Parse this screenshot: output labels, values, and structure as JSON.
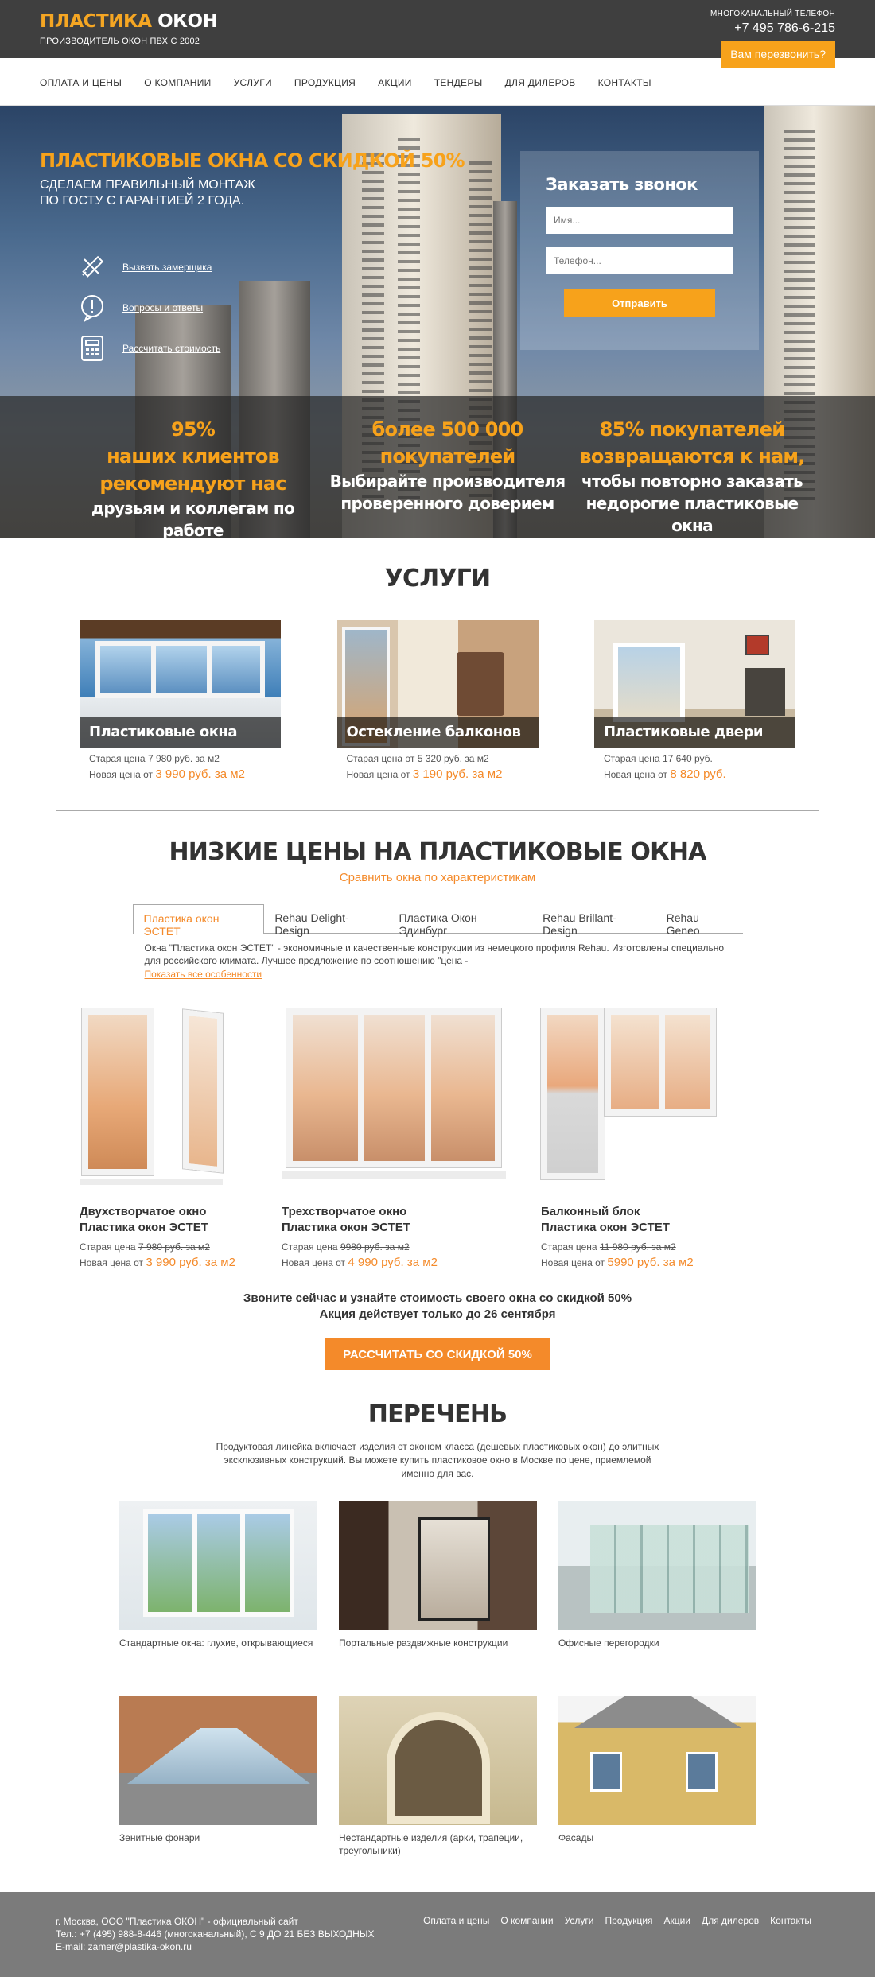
{
  "header": {
    "logo_part1": "ПЛАСТИКА",
    "logo_part2": "ОКОН",
    "tagline": "ПРОИЗВОДИТЕЛЬ ОКОН ПВХ С 2002",
    "phone_caption": "МНОГОКАНАЛЬНЫЙ ТЕЛЕФОН",
    "phone": "+7 495 786-6-215",
    "callback_label": "Вам перезвонить?"
  },
  "nav": {
    "items": [
      "ОПЛАТА И ЦЕНЫ",
      "О КОМПАНИИ",
      "УСЛУГИ",
      "ПРОДУКЦИЯ",
      "АКЦИИ",
      "ТЕНДЕРЫ",
      "ДЛЯ ДИЛЕРОВ",
      "КОНТАКТЫ"
    ]
  },
  "hero": {
    "title": "ПЛАСТИКОВЫЕ ОКНА СО СКИДКОЙ 50%",
    "subtitle_line1": "СДЕЛАЕМ ПРАВИЛЬНЫЙ МОНТАЖ",
    "subtitle_line2": "ПО ГОСТУ С ГАРАНТИЕЙ 2 ГОДА.",
    "links": [
      {
        "label": "Вызвать замерщика",
        "icon": "ruler-pencil-icon"
      },
      {
        "label": "Вопросы и ответы",
        "icon": "question-bubble-icon"
      },
      {
        "label": "Рассчитать стоимость",
        "icon": "calculator-icon"
      }
    ],
    "form": {
      "title": "Заказать звонок",
      "name_placeholder": "Имя...",
      "phone_placeholder": "Телефон...",
      "submit_label": "Отправить"
    },
    "stats": [
      {
        "orange1": "95%",
        "orange2": "наших клиентов",
        "orange3": "рекомендуют нас",
        "white1": "друзьям и коллегам по работе"
      },
      {
        "orange1": "более 500 000",
        "orange2": "покупателей",
        "white1": "Выбирайте производителя",
        "white2": "проверенного доверием"
      },
      {
        "orange1": "85% покупателей",
        "orange2": "возвращаются к нам,",
        "white1": "чтобы повторно заказать",
        "white2": "недорогие пластиковые окна"
      }
    ]
  },
  "services": {
    "title": "УСЛУГИ",
    "items": [
      {
        "name": "Пластиковые окна",
        "old_label": "Старая цена",
        "old_value": "7 980 руб. за м2",
        "new_label": "Новая цена от",
        "new_value": "3 990 руб. за м2"
      },
      {
        "name": "Остекление балконов",
        "old_label": "Старая цена от",
        "old_value": "5 320 руб. за м2",
        "new_label": "Новая цена от",
        "new_value": "3 190 руб. за м2"
      },
      {
        "name": "Пластиковые двери",
        "old_label": "Старая цена",
        "old_value": "17 640 руб.",
        "new_label": "Новая цена от",
        "new_value": "8 820 руб."
      }
    ]
  },
  "prices": {
    "title": "НИЗКИЕ ЦЕНЫ НА ПЛАСТИКОВЫЕ ОКНА",
    "subtitle": "Сравнить окна по характеристикам",
    "tabs": [
      "Пластика окон ЭСТЕТ",
      "Rehau Delight-Design",
      "Пластика Окон Эдинбург",
      "Rehau Brillant-Design",
      "Rehau Geneo"
    ],
    "description": "Окна \"Пластика окон ЭСТЕТ\" - экономичные и качественные конструкции из немецкого профиля Rehau. Изготовлены специально для российского климата. Лучшее предложение по соотношению \"цена -",
    "more_link": "Показать все особенности",
    "products": [
      {
        "name1": "Двухстворчатое окно",
        "name2": "Пластика окон ЭСТЕТ",
        "old_label": "Старая цена",
        "old_value": "7 980 руб. за м2",
        "new_label": "Новая цена от",
        "new_value": "3 990 руб. за м2"
      },
      {
        "name1": "Трехстворчатое окно",
        "name2": "Пластика окон ЭСТЕТ",
        "old_label": "Старая цена",
        "old_value": "9980 руб. за м2",
        "new_label": "Новая цена от",
        "new_value": "4 990 руб. за м2"
      },
      {
        "name1": "Балконный блок",
        "name2": "Пластика окон ЭСТЕТ",
        "old_label": "Старая цена",
        "old_value": "11 980 руб. за м2",
        "new_label": "Новая цена от",
        "new_value": "5990 руб. за м2"
      }
    ],
    "cta_line1": "Звоните сейчас и узнайте стоимость своего окна со скидкой 50%",
    "cta_line2": "Акция действует только до 26 сентября",
    "cta_button": "РАССЧИТАТЬ СО СКИДКОЙ 50%"
  },
  "list": {
    "title": "ПЕРЕЧЕНЬ",
    "intro": "Продуктовая линейка включает изделия от эконом класса (дешевых пластиковых окон) до элитных эксклюзивных конструкций. Вы можете купить пластиковое окно в Москве по цене, приемлемой именно для вас.",
    "items": [
      {
        "caption": "Стандартные окна: глухие, открывающиеся"
      },
      {
        "caption": "Портальные раздвижные конструкции"
      },
      {
        "caption": "Офисные перегородки"
      },
      {
        "caption": "Зенитные фонари"
      },
      {
        "caption": "Нестандартные изделия (арки, трапеции, треугольники)"
      },
      {
        "caption": "Фасады"
      }
    ]
  },
  "footer": {
    "line1": "г. Москва, ООО \"Пластика ОКОН\" - официальный сайт",
    "line2": "Тел.: +7 (495) 988-8-446 (многоканальный), С 9 ДО 21 БЕЗ ВЫХОДНЫХ",
    "line3": "E-mail: zamer@plastika-okon.ru",
    "nav": [
      "Оплата и цены",
      "О компании",
      "Услуги",
      "Продукция",
      "Акции",
      "Для дилеров",
      "Контакты"
    ]
  },
  "colors": {
    "accent": "#f7a21b",
    "accent_dark": "#f48a2a",
    "header_bg": "#3f3f3f",
    "footer_bg": "#7b7b7b"
  }
}
